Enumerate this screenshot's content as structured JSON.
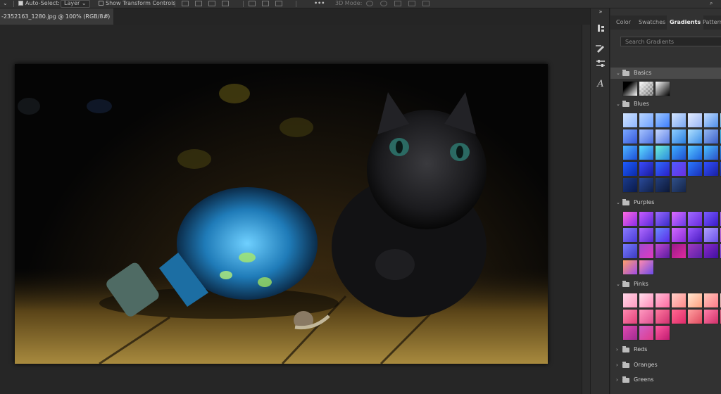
{
  "options_bar": {
    "auto_select_label": "Auto-Select:",
    "layer_select_value": "Layer",
    "show_transform_label": "Show Transform Controls",
    "more_label": "•••",
    "mode_3d_label": "3D Mode:"
  },
  "document": {
    "tab_title": "-2352163_1280.jpg @ 100% (RGB/8#)",
    "close_glyph": "×"
  },
  "panel": {
    "tabs": [
      {
        "label": "Color"
      },
      {
        "label": "Swatches"
      },
      {
        "label": "Gradients",
        "active": true
      },
      {
        "label": "Patterns"
      }
    ],
    "search_placeholder": "Search Gradients",
    "groups": {
      "basics": {
        "label": "Basics",
        "expanded": true
      },
      "blues": {
        "label": "Blues",
        "expanded": true
      },
      "purples": {
        "label": "Purples",
        "expanded": true
      },
      "pinks": {
        "label": "Pinks",
        "expanded": true
      },
      "reds": {
        "label": "Reds",
        "expanded": false
      },
      "oranges": {
        "label": "Oranges",
        "expanded": false
      },
      "greens": {
        "label": "Greens",
        "expanded": false
      }
    }
  },
  "icons": {
    "collapse": "»",
    "tool_history": "history-brush-icon",
    "tool_brush": "brush-settings-icon",
    "tool_adjust": "adjustments-icon",
    "tool_glyphs": "glyphs-icon"
  },
  "colors": {
    "panel_bg": "#323232",
    "app_bg": "#282828",
    "active_group_bg": "#4a4a4a"
  }
}
